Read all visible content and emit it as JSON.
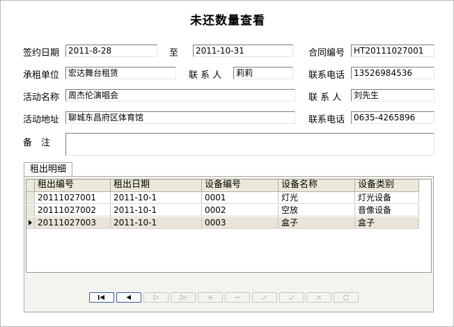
{
  "title": "未还数量查看",
  "form": {
    "sign_date_label": "签约日期",
    "sign_date": "2011-8-28",
    "to_label": "至",
    "end_date": "2011-10-31",
    "contract_no_label": "合同编号",
    "contract_no": "HT20111027001",
    "renter_label": "承租单位",
    "renter": "宏达舞台租赁",
    "contact1_label": "联 系 人",
    "contact1": "莉莉",
    "phone1_label": "联系电话",
    "phone1": "13526984536",
    "event_name_label": "活动名称",
    "event_name": "周杰伦演唱会",
    "contact2_label": "联 系 人",
    "contact2": "刘先生",
    "event_addr_label": "活动地址",
    "event_addr": "聊城东昌府区体育馆",
    "phone2_label": "联系电话",
    "phone2": "0635-4265896",
    "remark_label": "备　注",
    "remark": ""
  },
  "tab_label": "租出明细",
  "grid": {
    "headers": [
      "租出编号",
      "租出日期",
      "设备编号",
      "设备名称",
      "设备类别"
    ],
    "rows": [
      [
        "20111027001",
        "2011-10-1",
        "0001",
        "灯光",
        "灯光设备"
      ],
      [
        "20111027002",
        "2011-10-1",
        "0002",
        "空放",
        "音像设备"
      ],
      [
        "20111027003",
        "2011-10-1",
        "0003",
        "盒子",
        "盒子"
      ]
    ],
    "selected_row": 2
  },
  "nav": {
    "buttons": [
      "first-icon",
      "prev-icon",
      "next-icon",
      "last-icon",
      "add-icon",
      "delete-icon",
      "edit-icon",
      "post-icon",
      "cancel-icon",
      "refresh-icon"
    ]
  }
}
